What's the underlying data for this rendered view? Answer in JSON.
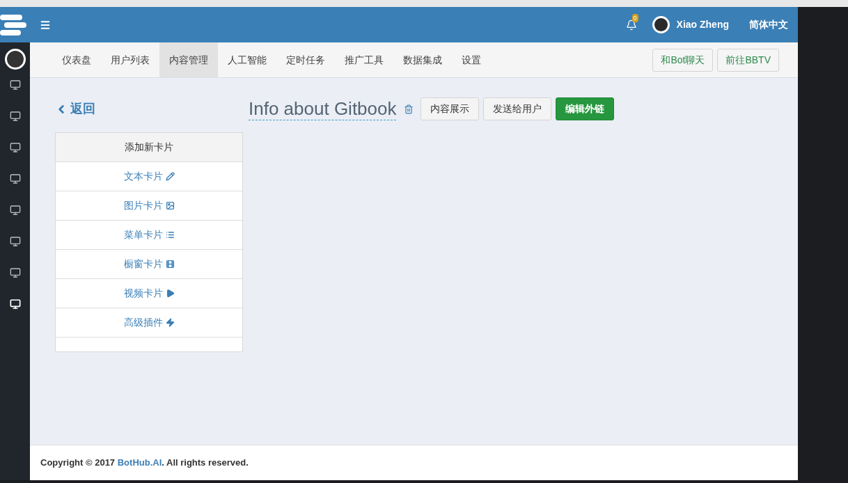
{
  "header": {
    "notification_count": "0",
    "user_name": "Xiao Zheng",
    "language": "简体中文"
  },
  "sidebar": {
    "items": [
      {
        "selected": false
      },
      {
        "selected": false
      },
      {
        "selected": false
      },
      {
        "selected": false
      },
      {
        "selected": false
      },
      {
        "selected": false
      },
      {
        "selected": false
      },
      {
        "selected": true
      }
    ]
  },
  "nav": {
    "tabs": [
      {
        "label": "仪表盘",
        "selected": false
      },
      {
        "label": "用户列表",
        "selected": false
      },
      {
        "label": "内容管理",
        "selected": true
      },
      {
        "label": "人工智能",
        "selected": false
      },
      {
        "label": "定时任务",
        "selected": false
      },
      {
        "label": "推广工具",
        "selected": false
      },
      {
        "label": "数据集成",
        "selected": false
      },
      {
        "label": "设置",
        "selected": false
      }
    ],
    "buttons": [
      "和Bot聊天",
      "前往BBTV"
    ]
  },
  "page": {
    "back": "返回",
    "title": "Info about Gitbook",
    "actions": [
      {
        "label": "内容展示",
        "kind": "default"
      },
      {
        "label": "发送给用户",
        "kind": "default"
      },
      {
        "label": "编辑外链",
        "kind": "primary"
      }
    ]
  },
  "card_menu": {
    "heading": "添加新卡片",
    "items": [
      {
        "label": "文本卡片",
        "kind": "text"
      },
      {
        "label": "图片卡片",
        "kind": "image"
      },
      {
        "label": "菜单卡片",
        "kind": "menu"
      },
      {
        "label": "橱窗卡片",
        "kind": "gallery"
      },
      {
        "label": "视频卡片",
        "kind": "video"
      },
      {
        "label": "高级插件",
        "kind": "plugin"
      }
    ]
  },
  "footer": {
    "prefix": "Copyright © 2017 ",
    "link": "BotHub.AI",
    "suffix": ". All rights reserved."
  }
}
